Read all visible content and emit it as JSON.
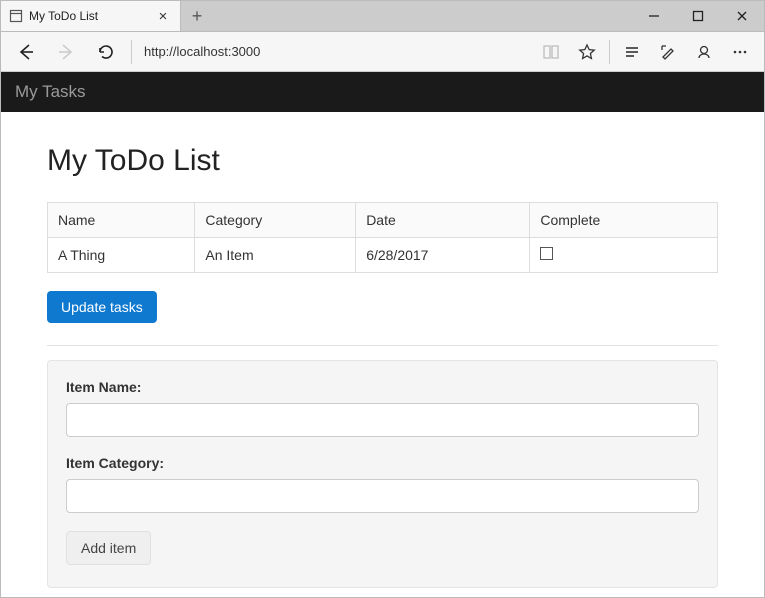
{
  "browser": {
    "tab_title": "My ToDo List",
    "url": "http://localhost:3000"
  },
  "nav": {
    "brand": "My Tasks"
  },
  "heading": "My ToDo List",
  "table": {
    "headers": {
      "name": "Name",
      "category": "Category",
      "date": "Date",
      "complete": "Complete"
    },
    "rows": [
      {
        "name": "A Thing",
        "category": "An Item",
        "date": "6/28/2017",
        "complete": false
      }
    ]
  },
  "buttons": {
    "update": "Update tasks",
    "add": "Add item"
  },
  "form": {
    "name_label": "Item Name:",
    "category_label": "Item Category:",
    "name_value": "",
    "category_value": ""
  }
}
